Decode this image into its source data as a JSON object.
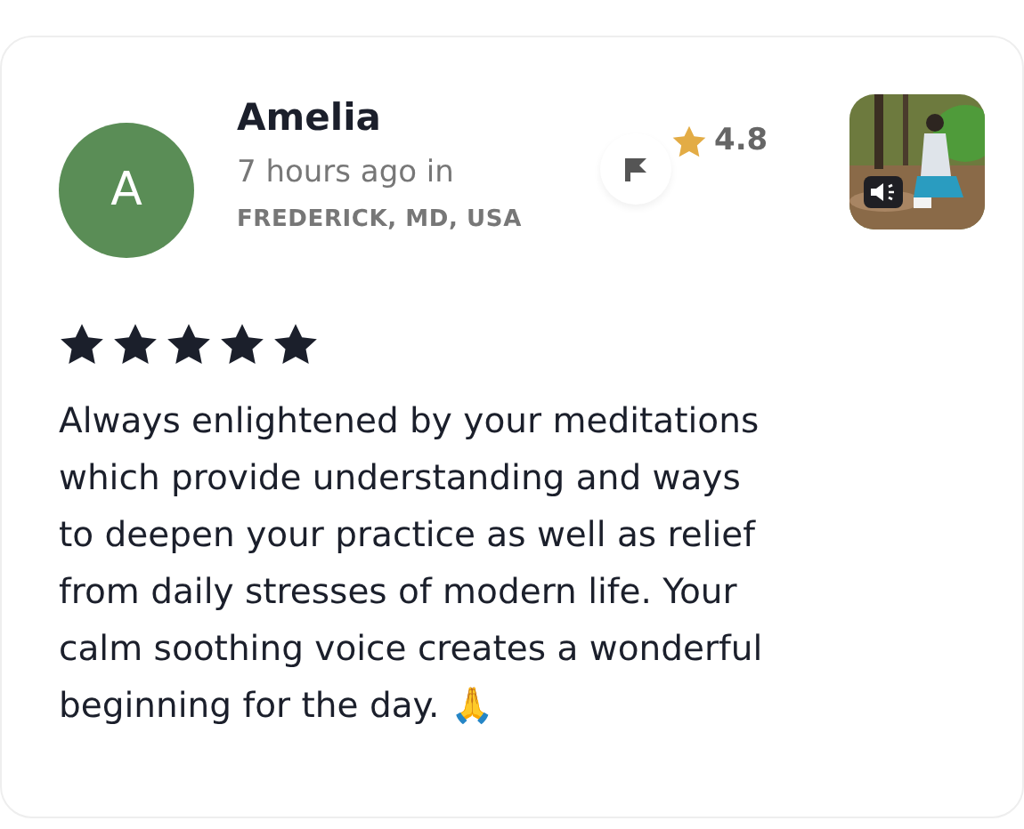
{
  "review": {
    "avatar": {
      "letter": "A",
      "color": "#5a8d56"
    },
    "name": "Amelia",
    "time": "7 hours ago in",
    "location": "FREDERICK, MD, USA",
    "rating": "4.8",
    "stars": 5,
    "text": "Always enlightened by your meditations which provide understanding and ways to deepen your practice as well as relief from daily stresses of modern life. Your calm soothing voice creates a wonderful beginning for the day. 🙏"
  }
}
